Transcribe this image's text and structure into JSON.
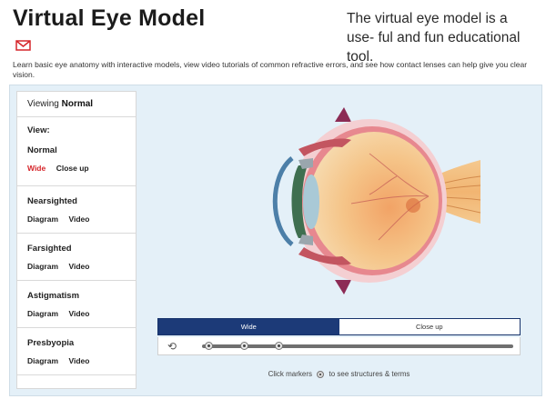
{
  "header": {
    "title": "Virtual Eye Model",
    "caption": "The virtual eye model is a use- ful and fun educational tool.",
    "intro": "Learn basic eye anatomy with interactive models, view video tutorials of common refractive errors, and see how contact lenses can help give you clear vision."
  },
  "sidebar": {
    "viewing_label": "Viewing",
    "viewing_value": "Normal",
    "view_label": "View:",
    "sections": [
      {
        "name": "Normal",
        "link1": "Wide",
        "link2": "Close up"
      },
      {
        "name": "Nearsighted",
        "link1": "Diagram",
        "link2": "Video"
      },
      {
        "name": "Farsighted",
        "link1": "Diagram",
        "link2": "Video"
      },
      {
        "name": "Astigmatism",
        "link1": "Diagram",
        "link2": "Video"
      },
      {
        "name": "Presbyopia",
        "link1": "Diagram",
        "link2": "Video"
      }
    ]
  },
  "controls": {
    "tab_wide": "Wide",
    "tab_closeup": "Close up",
    "hint_before": "Click markers",
    "hint_after": "to see structures & terms"
  },
  "colors": {
    "accent_red": "#d6262b",
    "tab_blue": "#1c3a78",
    "panel_bg": "#e4f0f8"
  },
  "icons": {
    "mail": "mail-icon",
    "rotate": "rotate-icon"
  }
}
